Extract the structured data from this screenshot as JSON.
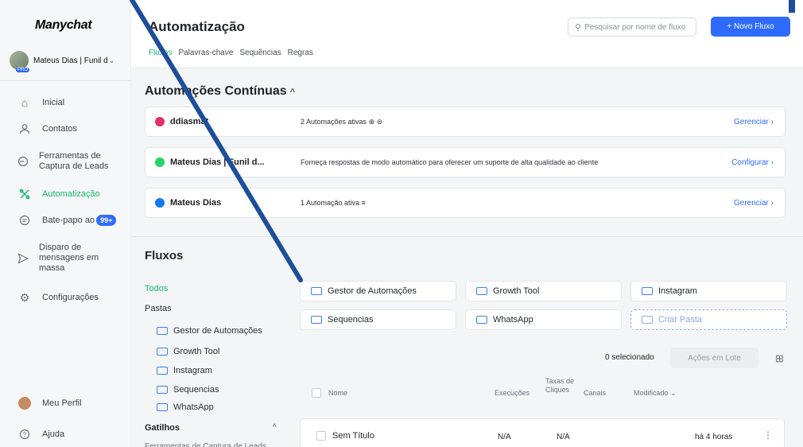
{
  "brand": {
    "logo": "Manychat"
  },
  "account": {
    "name": "Mateus Dias | Funil d",
    "badge": "PRO"
  },
  "nav": [
    {
      "label": "Inicial",
      "icon": "home-icon"
    },
    {
      "label": "Contatos",
      "icon": "user-icon"
    },
    {
      "label": "Ferramentas de Captura de Leads",
      "icon": "lead-capture-icon"
    },
    {
      "label": "Automatização",
      "icon": "automation-icon"
    },
    {
      "label": "Bate-papo ao",
      "icon": "chat-icon",
      "badge": "99+"
    },
    {
      "label": "Disparo de mensagens em massa",
      "icon": "send-icon"
    },
    {
      "label": "Configurações",
      "icon": "settings-icon"
    }
  ],
  "bottom_nav": [
    {
      "label": "Meu Perfil"
    },
    {
      "label": "Ajuda"
    }
  ],
  "header": {
    "title": "Automatização",
    "search_placeholder": "Pesquisar por nome de fluxo",
    "new_flow": "+ Novo Fluxo",
    "tabs": [
      "Fluxos",
      "Palavras-chave",
      "Sequências",
      "Regras"
    ]
  },
  "continuous": {
    "title": "Automações Contínuas",
    "cards": [
      {
        "name": "ddiasmat",
        "desc": "2 Automações ativas",
        "action": "Gerenciar ›",
        "color": "#e1306c"
      },
      {
        "name": "Mateus Dias | Funil d...",
        "desc": "Forneça respostas de modo automático para oferecer um suporte de alta qualidade ao cliente",
        "action": "Configurar ›",
        "color": "#25d366"
      },
      {
        "name": "Mateus Dias",
        "desc": "1 Automação ativa",
        "action": "Gerenciar ›",
        "color": "#1877f2"
      }
    ]
  },
  "flows": {
    "title": "Fluxos",
    "filters": {
      "all": "Todos",
      "folders": "Pastas",
      "triggers": "Gatilhos",
      "trigger_sub": "Ferramentas de Captura de Leads"
    },
    "folder_list": [
      "Gestor de Automações",
      "Growth Tool",
      "Instagram",
      "Sequencias",
      "WhatsApp"
    ],
    "folder_cards": [
      "Gestor de Automações",
      "Growth Tool",
      "Instagram",
      "Sequencias",
      "WhatsApp"
    ],
    "create_folder": "Criar Pasta",
    "selected": "0 selecionado",
    "bulk_actions": "Ações em Lote",
    "columns": {
      "name": "Nome",
      "runs": "Execuções",
      "ctr": "Taxas de Cliques",
      "channels": "Canais",
      "modified": "Modificado ⌄"
    },
    "rows": [
      {
        "name": "Sem Título",
        "runs": "N/A",
        "ctr": "N/A",
        "modified": "há 4 horas"
      }
    ]
  }
}
